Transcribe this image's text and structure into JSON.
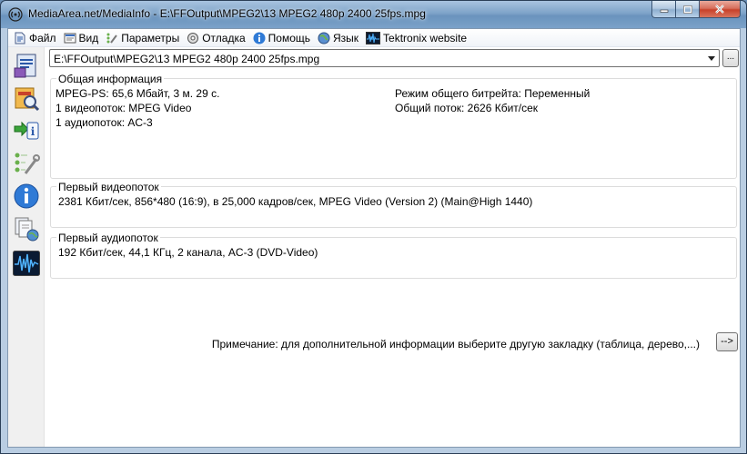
{
  "window": {
    "title": "MediaArea.net/MediaInfo - E:\\FFOutput\\MPEG2\\13 MPEG2 480p 2400 25fps.mpg"
  },
  "menu": [
    {
      "label": "Файл",
      "icon": "file-icon"
    },
    {
      "label": "Вид",
      "icon": "view-icon"
    },
    {
      "label": "Параметры",
      "icon": "options-icon"
    },
    {
      "label": "Отладка",
      "icon": "debug-icon"
    },
    {
      "label": "Помощь",
      "icon": "help-icon"
    },
    {
      "label": "Язык",
      "icon": "language-icon"
    },
    {
      "label": "Tektronix website",
      "icon": "tektronix-icon"
    }
  ],
  "sidebar": [
    {
      "icon": "open-file-icon"
    },
    {
      "icon": "open-folder-icon"
    },
    {
      "icon": "export-icon"
    },
    {
      "icon": "preferences-icon"
    },
    {
      "icon": "about-icon"
    },
    {
      "icon": "website-icon"
    },
    {
      "icon": "tektronix-waveform-icon"
    }
  ],
  "file": {
    "selected": "E:\\FFOutput\\MPEG2\\13 MPEG2 480p 2400 25fps.mpg",
    "browse_label": "..."
  },
  "general": {
    "title": "Общая информация",
    "left": [
      "MPEG-PS: 65,6 Мбайт, 3 м. 29 с.",
      "1 видеопоток: MPEG Video",
      "1 аудиопоток: AC-3"
    ],
    "right": [
      "Режим общего битрейта: Переменный",
      "Общий поток: 2626 Кбит/сек"
    ]
  },
  "video": {
    "title": "Первый видеопоток",
    "line": "2381 Кбит/сек, 856*480 (16:9), в 25,000 кадров/сек, MPEG Video (Version 2) (Main@High 1440)"
  },
  "audio": {
    "title": "Первый аудиопоток",
    "line": "192 Кбит/сек, 44,1 КГц, 2 канала, AC-3 (DVD-Video)"
  },
  "footer": {
    "note": "Примечание: для дополнительной информации выберите другую закладку (таблица, дерево,...)",
    "more_label": "-->"
  }
}
